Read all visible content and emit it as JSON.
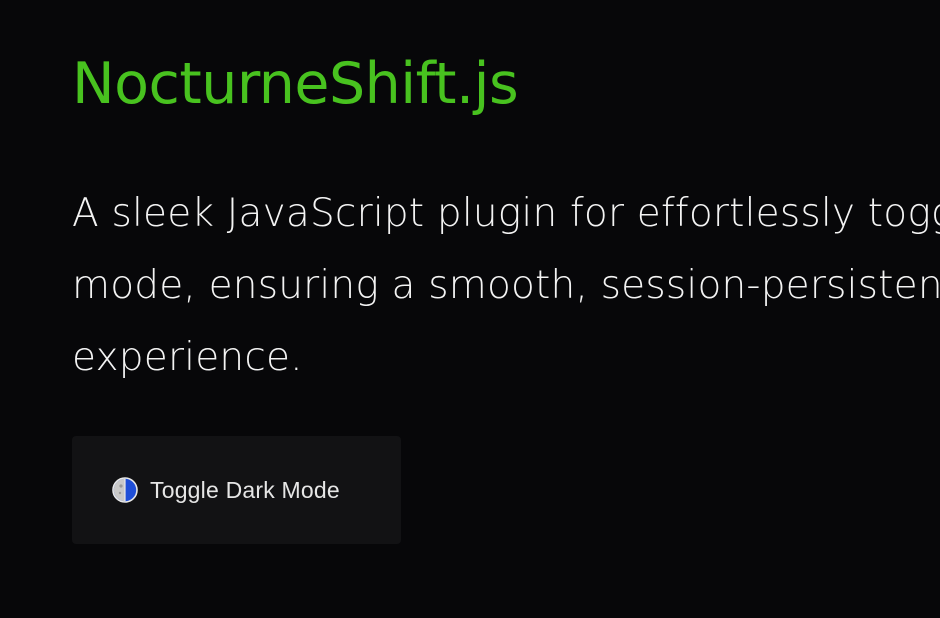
{
  "header": {
    "title": "NocturneShift.js"
  },
  "main": {
    "description": "A sleek JavaScript plugin for effortlessly toggling dark mode, ensuring a smooth, session-persistent visual experience."
  },
  "toggle": {
    "label": "Toggle Dark Mode",
    "icon": "half-moon-icon"
  },
  "colors": {
    "background": "#070709",
    "title": "#48c21f",
    "text": "#f3f3f3",
    "button_background": "#121214",
    "icon_accent": "#1f4fd8"
  }
}
